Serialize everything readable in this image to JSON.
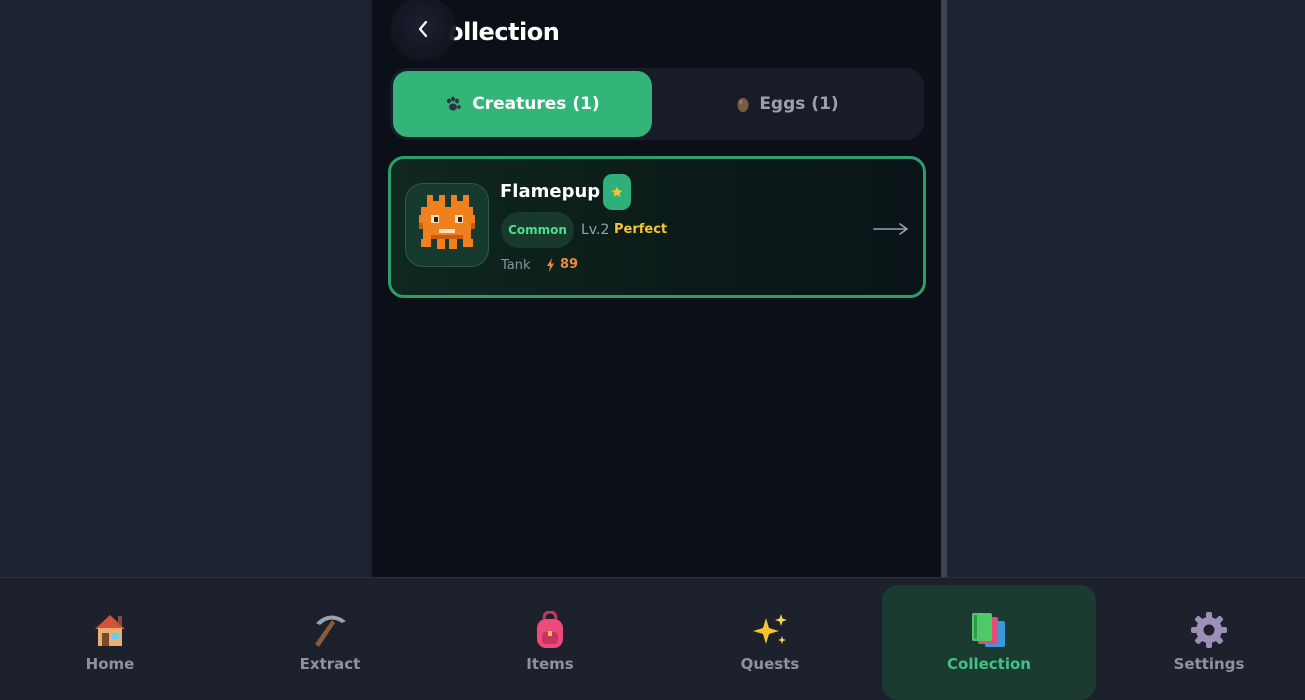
{
  "header": {
    "title": "Collection",
    "back_icon": "chevron-left-icon"
  },
  "tabs": [
    {
      "label": "Creatures (1)",
      "icon": "paw-icon",
      "active": true
    },
    {
      "label": "Eggs (1)",
      "icon": "egg-icon",
      "active": false
    }
  ],
  "creatures": [
    {
      "name": "Flamepup",
      "favorite_icon": "star-icon",
      "rarity": "Common",
      "level": "Lv.2",
      "quality": "Perfect",
      "role": "Tank",
      "power": "89",
      "power_icon": "lightning-icon"
    }
  ],
  "nav": [
    {
      "label": "Home",
      "icon": "house-icon"
    },
    {
      "label": "Extract",
      "icon": "pickaxe-icon"
    },
    {
      "label": "Items",
      "icon": "backpack-icon"
    },
    {
      "label": "Quests",
      "icon": "sparkles-icon"
    },
    {
      "label": "Collection",
      "icon": "books-icon",
      "active": true
    },
    {
      "label": "Settings",
      "icon": "gear-icon"
    }
  ],
  "colors": {
    "accent": "#33b57a",
    "panel": "#0b0f18",
    "background": "#1c2230",
    "rarity_common": "#4fdc93",
    "quality_perfect": "#f6c431",
    "power": "#f0883e"
  }
}
